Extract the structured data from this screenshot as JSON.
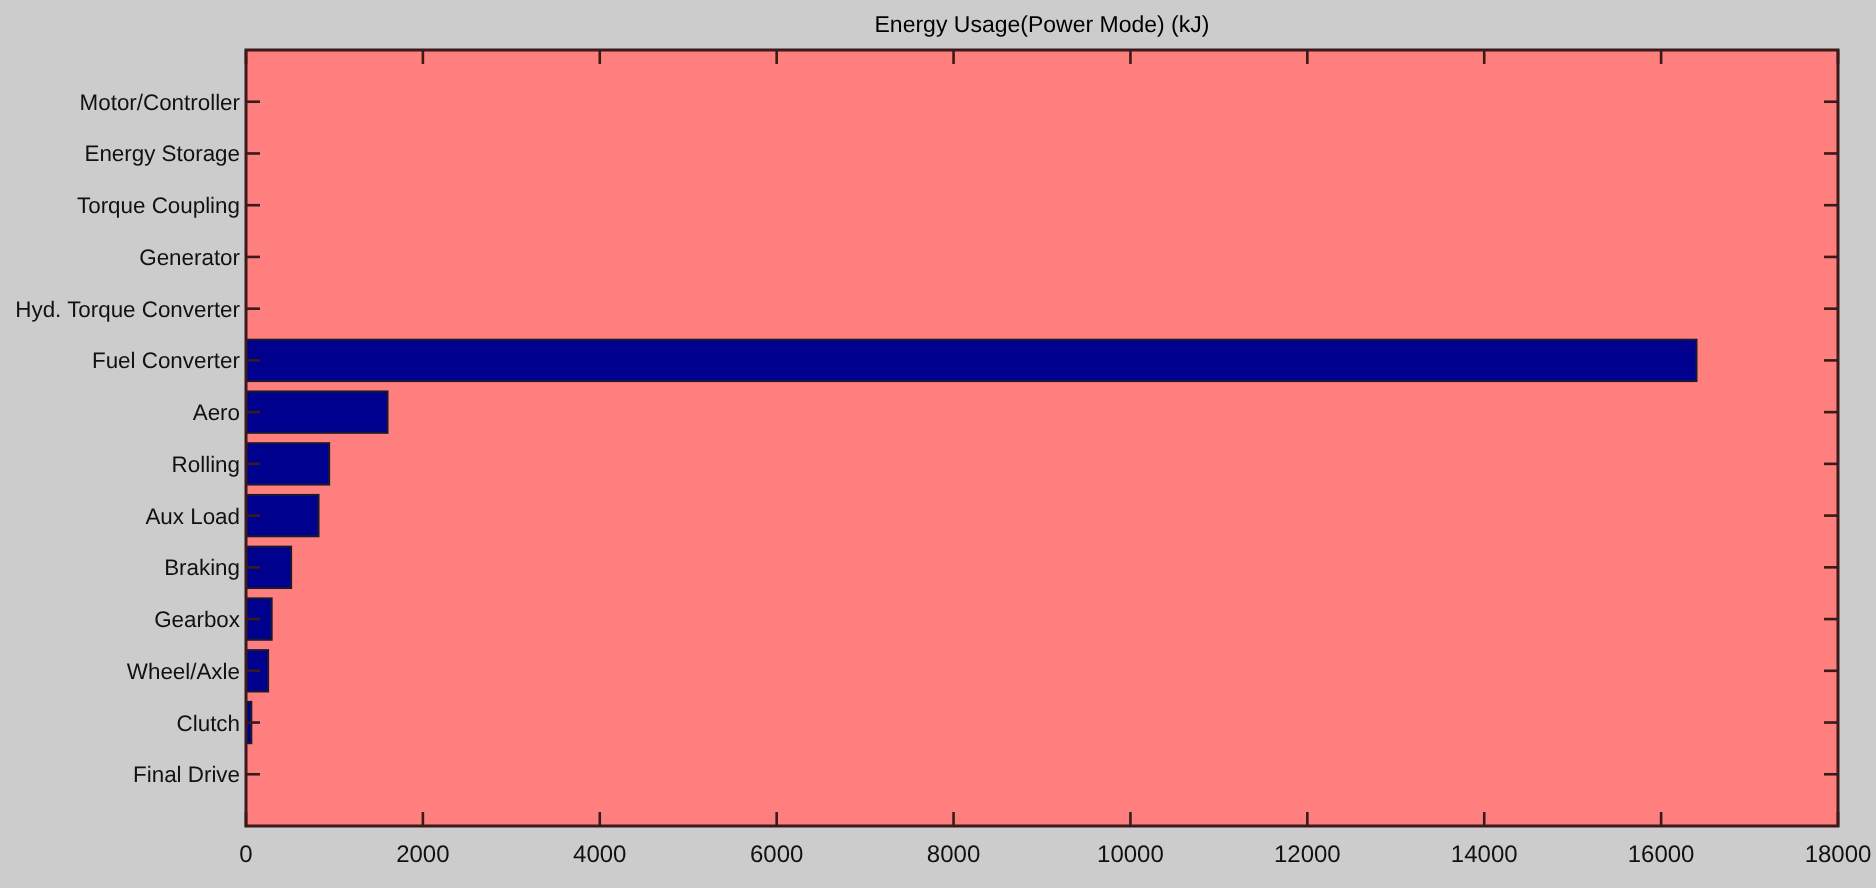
{
  "figure": {
    "chart_data": {
      "type": "bar",
      "orientation": "horizontal",
      "title": "Energy Usage(Power Mode) (kJ)",
      "categories": [
        "Motor/Controller",
        "Energy Storage",
        "Torque Coupling",
        "Generator",
        "Hyd. Torque Converter",
        "Fuel Converter",
        "Aero",
        "Rolling",
        "Aux Load",
        "Braking",
        "Gearbox",
        "Wheel/Axle",
        "Clutch",
        "Final Drive"
      ],
      "series": [
        {
          "color": "#00008f",
          "values": [
            0,
            0,
            0,
            0,
            0,
            16400,
            1600,
            940,
            820,
            510,
            290,
            250,
            60,
            0
          ]
        }
      ],
      "xlim": [
        0,
        18000
      ],
      "xticks": [
        0,
        2000,
        4000,
        6000,
        8000,
        10000,
        12000,
        14000,
        16000,
        18000
      ]
    }
  }
}
